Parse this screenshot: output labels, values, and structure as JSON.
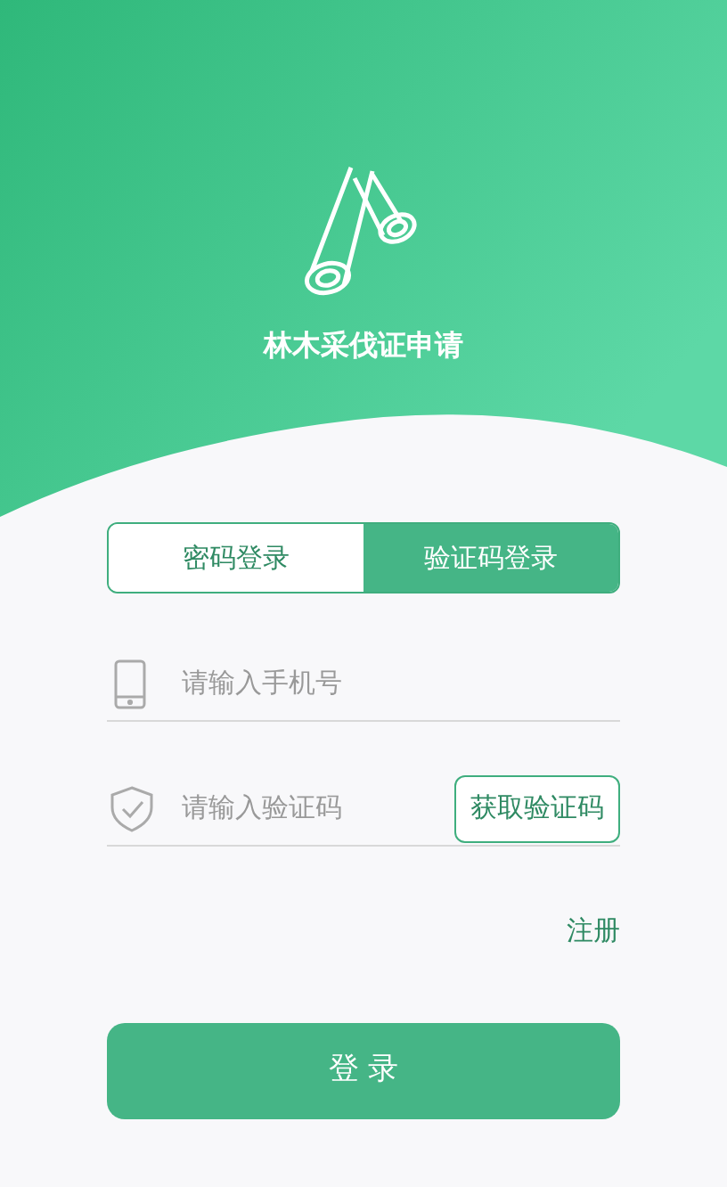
{
  "app": {
    "title": "林木采伐证申请"
  },
  "tabs": [
    {
      "label": "密码登录",
      "selected": false
    },
    {
      "label": "验证码登录",
      "selected": true
    }
  ],
  "phone_field": {
    "placeholder": "请输入手机号"
  },
  "code_field": {
    "placeholder": "请输入验证码"
  },
  "get_code_button": "获取验证码",
  "register_link": "注册",
  "login_button": "登 录"
}
